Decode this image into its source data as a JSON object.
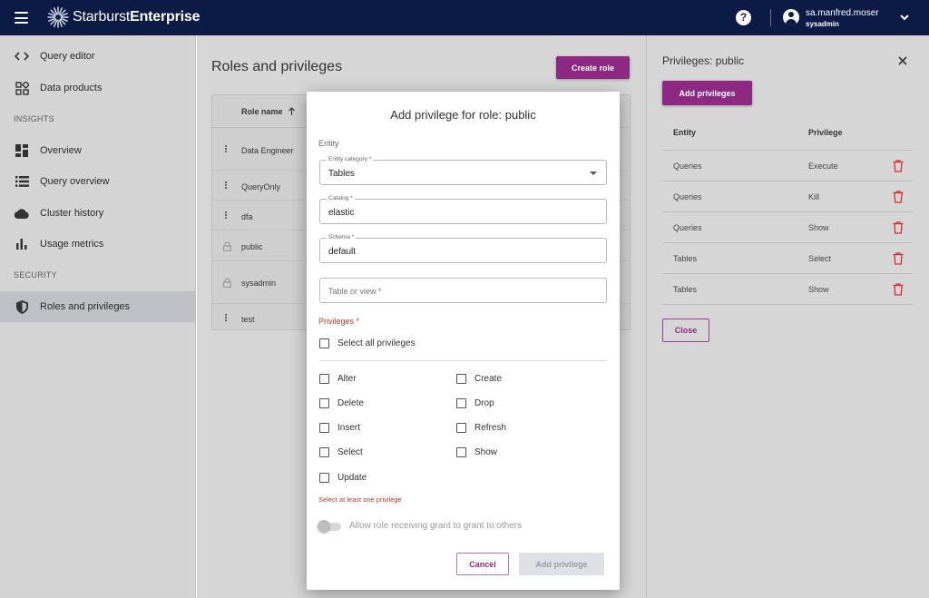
{
  "topbar": {
    "brand_regular": "Starburst",
    "brand_bold": "Enterprise",
    "help": "?",
    "user_name": "sa.manfred.moser",
    "user_role": "sysadmin"
  },
  "sidebar": {
    "items": [
      {
        "label": "Query editor",
        "icon": "code-icon"
      },
      {
        "label": "Data products",
        "icon": "data-products-icon"
      }
    ],
    "insights_label": "INSIGHTS",
    "insights": [
      {
        "label": "Overview",
        "icon": "dashboard-icon"
      },
      {
        "label": "Query overview",
        "icon": "list-icon"
      },
      {
        "label": "Cluster history",
        "icon": "cloud-icon"
      },
      {
        "label": "Usage metrics",
        "icon": "bar-chart-icon"
      }
    ],
    "security_label": "SECURITY",
    "security": [
      {
        "label": "Roles and privileges",
        "icon": "shield-icon",
        "active": true
      }
    ]
  },
  "main": {
    "title": "Roles and privileges",
    "create_role": "Create role",
    "column_header": "Role name",
    "rows": [
      {
        "name": "Data Engineer",
        "locked": false
      },
      {
        "name": "QueryOnly",
        "locked": false
      },
      {
        "name": "dfa",
        "locked": false
      },
      {
        "name": "public",
        "locked": true
      },
      {
        "name": "sysadmin",
        "locked": true
      },
      {
        "name": "test",
        "locked": false
      }
    ]
  },
  "panel": {
    "title": "Privileges: public",
    "add_button": "Add privileges",
    "col_entity": "Entity",
    "col_privilege": "Privilege",
    "rows": [
      {
        "entity": "Queries",
        "privilege": "Execute"
      },
      {
        "entity": "Queries",
        "privilege": "Kill"
      },
      {
        "entity": "Queries",
        "privilege": "Show"
      },
      {
        "entity": "Tables",
        "privilege": "Select"
      },
      {
        "entity": "Tables",
        "privilege": "Show"
      }
    ],
    "close_button": "Close"
  },
  "modal": {
    "title": "Add privilege for role: public",
    "entity_section": "Entity",
    "entity_category_label": "Entity category *",
    "entity_category_value": "Tables",
    "catalog_label": "Catalog *",
    "catalog_value": "elastic",
    "schema_label": "Schema *",
    "schema_value": "default",
    "table_placeholder": "Table or view *",
    "privileges_label": "Privileges *",
    "select_all": "Select all privileges",
    "privileges_left": [
      "Alter",
      "Delete",
      "Insert",
      "Select",
      "Update"
    ],
    "privileges_right": [
      "Create",
      "Drop",
      "Refresh",
      "Show"
    ],
    "error": "Select at least one privilege",
    "toggle_label": "Allow role receiving grant to grant to others",
    "cancel": "Cancel",
    "add": "Add privilege"
  },
  "colors": {
    "topbar": "#0c1b46",
    "accent": "#8d2983",
    "error": "#c0392b"
  }
}
